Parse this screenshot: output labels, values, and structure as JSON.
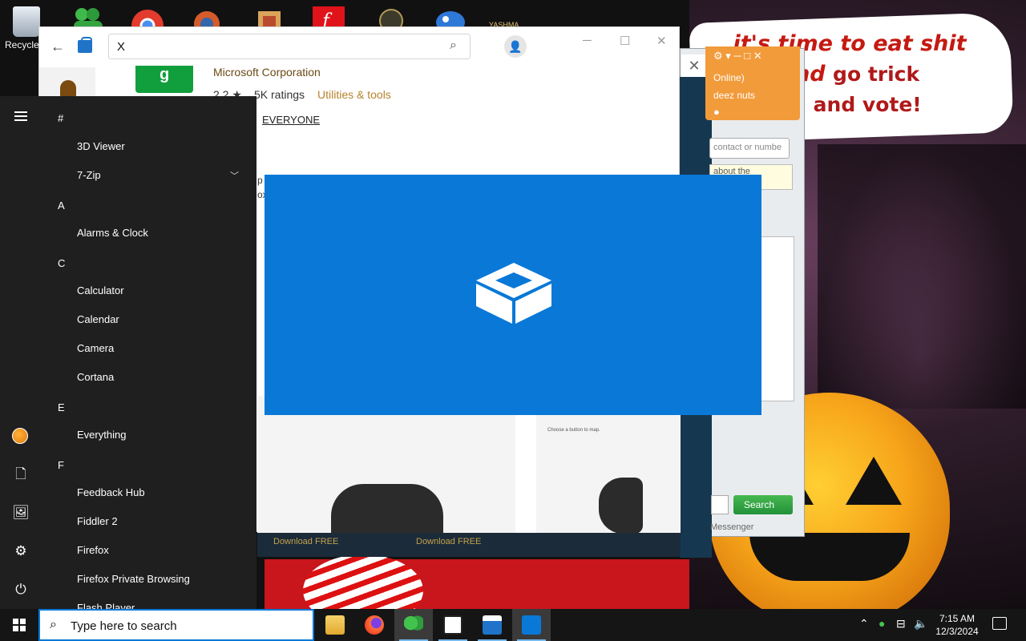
{
  "desktop": {
    "recycle_label": "Recycle",
    "icon_partial_label": "YASHMA",
    "bubble_line1": "it's time to eat shit",
    "bubble_line2a": "and",
    "bubble_line2b": "go trick",
    "bubble_line3": "ng and vote!"
  },
  "messenger": {
    "status": "Online)",
    "contact": "deez nuts",
    "search_placeholder": "contact or numbe",
    "box_text": "about the",
    "search_button": "Search",
    "footer": "Messenger"
  },
  "store": {
    "search_value": "X",
    "publisher": "Microsoft Corporation",
    "rating": "2.2 ★",
    "ratings_count": "5K ratings",
    "category": "Utilities & tools",
    "age_rating": "EVERYONE",
    "cut_text_1": "p",
    "cut_text_2": "ox",
    "choose_button": "Choose a button to map.",
    "download_1": "Download FREE",
    "download_2": "Download FREE"
  },
  "start_menu": {
    "sections": [
      {
        "letter": "#",
        "items": [
          "3D Viewer",
          "7-Zip"
        ]
      },
      {
        "letter": "A",
        "items": [
          "Alarms & Clock"
        ]
      },
      {
        "letter": "C",
        "items": [
          "Calculator",
          "Calendar",
          "Camera",
          "Cortana"
        ]
      },
      {
        "letter": "E",
        "items": [
          "Everything"
        ]
      },
      {
        "letter": "F",
        "items": [
          "Feedback Hub",
          "Fiddler 2",
          "Firefox",
          "Firefox Private Browsing",
          "Flash Player"
        ]
      }
    ]
  },
  "taskbar": {
    "search_placeholder": "Type here to search",
    "time": "7:15 AM",
    "date": "12/3/2024"
  },
  "colors": {
    "accent": "#0078d7",
    "splash": "#0a78d7",
    "start_bg": "#1f1f1f",
    "taskbar_bg": "#151515"
  }
}
